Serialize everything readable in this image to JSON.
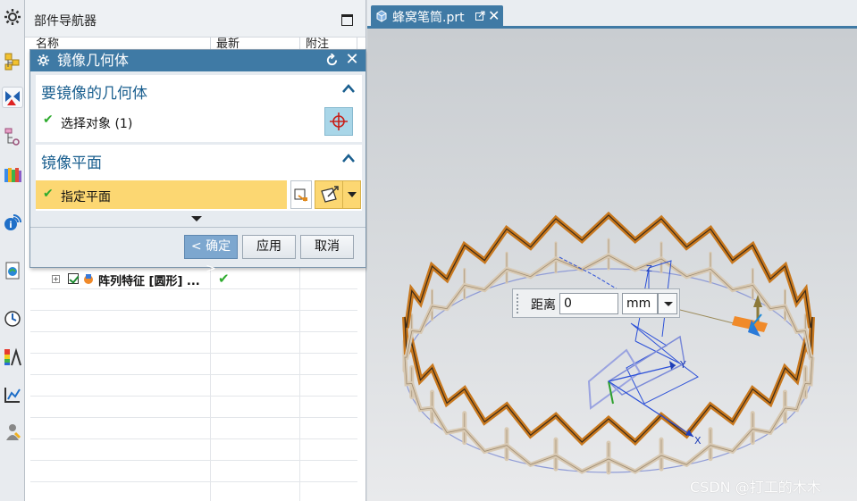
{
  "left_toolbar": {
    "buttons": [
      {
        "name": "gear-icon"
      },
      {
        "name": "assembly-navigator-icon"
      },
      {
        "name": "constraint-navigator-icon"
      },
      {
        "name": "part-navigator-icon"
      },
      {
        "name": "reuse-library-icon"
      },
      {
        "name": "info-icon"
      },
      {
        "name": "web-browser-icon"
      },
      {
        "name": "history-icon"
      },
      {
        "name": "analysis-icon"
      },
      {
        "name": "process-studio-icon"
      },
      {
        "name": "roles-icon"
      }
    ]
  },
  "navigator": {
    "title": "部件导航器",
    "columns": [
      "名称",
      "最新",
      "附注"
    ],
    "feature_row": {
      "label": "阵列特征 [圆形] ...",
      "latest": "✔"
    }
  },
  "dialog": {
    "title": "镜像几何体",
    "geometry_group": {
      "title": "要镜像的几何体",
      "select_label": "选择对象 (1)"
    },
    "plane_group": {
      "title": "镜像平面",
      "specify_label": "指定平面"
    },
    "buttons": {
      "ok": "< 确定 >",
      "apply": "应用",
      "cancel": "取消"
    }
  },
  "graphics": {
    "tab_title": "蜂窝笔筒.prt",
    "distance": {
      "label": "距离",
      "value": "0",
      "unit": "mm"
    },
    "axis_labels": {
      "x": "X",
      "y": "Y",
      "z": "Z"
    }
  },
  "watermark": "CSDN @打工的木木",
  "colors": {
    "titlebar": "#3f7aa5",
    "group_title": "#1a5f8f",
    "highlight": "#fcd772",
    "honeycomb_orange": "#c8781e",
    "honeycomb_light": "#d8c9b3",
    "check_green": "#2eab2e"
  }
}
